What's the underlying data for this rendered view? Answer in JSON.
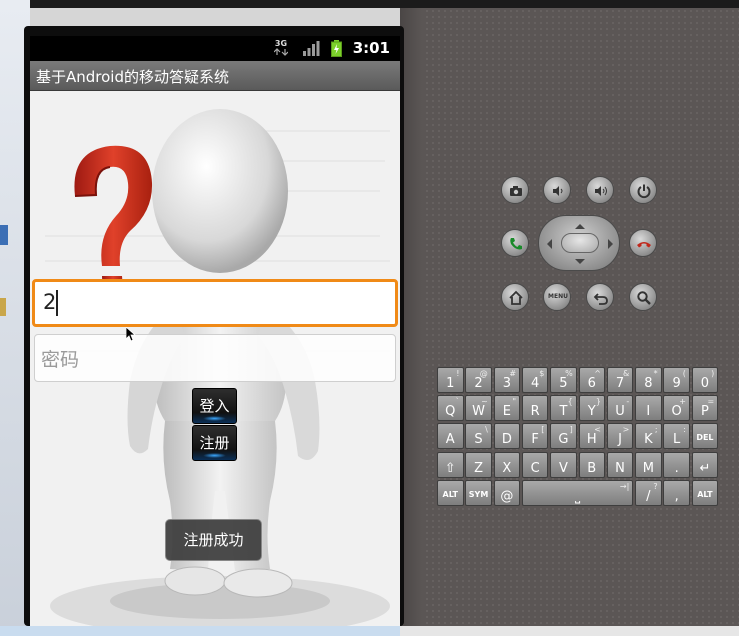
{
  "status_bar": {
    "network": "3G",
    "time": "3:01"
  },
  "app": {
    "title": "基于Android的移动答疑系统"
  },
  "form": {
    "username_value": "2",
    "password_placeholder": "密码",
    "login_label": "登入",
    "register_label": "注册"
  },
  "toast": {
    "message": "注册成功"
  },
  "hardware": {
    "buttons": [
      "camera-icon",
      "volume-down-icon",
      "volume-up-icon",
      "power-icon",
      "call-icon",
      "end-call-icon",
      "home-icon",
      "menu-button",
      "back-icon",
      "search-icon"
    ],
    "menu_label": "MENU"
  },
  "keyboard": {
    "rows": [
      [
        {
          "k": "1",
          "s": "!"
        },
        {
          "k": "2",
          "s": "@"
        },
        {
          "k": "3",
          "s": "#"
        },
        {
          "k": "4",
          "s": "$"
        },
        {
          "k": "5",
          "s": "%"
        },
        {
          "k": "6",
          "s": "^"
        },
        {
          "k": "7",
          "s": "&"
        },
        {
          "k": "8",
          "s": "*"
        },
        {
          "k": "9",
          "s": "("
        },
        {
          "k": "0",
          "s": ")"
        }
      ],
      [
        {
          "k": "Q",
          "s": "`"
        },
        {
          "k": "W",
          "s": "~"
        },
        {
          "k": "E",
          "s": "\""
        },
        {
          "k": "R",
          "s": ""
        },
        {
          "k": "T",
          "s": "{"
        },
        {
          "k": "Y",
          "s": "}"
        },
        {
          "k": "U",
          "s": "-"
        },
        {
          "k": "I",
          "s": ""
        },
        {
          "k": "O",
          "s": "+"
        },
        {
          "k": "P",
          "s": "="
        }
      ],
      [
        {
          "k": "A",
          "s": ""
        },
        {
          "k": "S",
          "s": "\\"
        },
        {
          "k": "D",
          "s": ""
        },
        {
          "k": "F",
          "s": "["
        },
        {
          "k": "G",
          "s": "]"
        },
        {
          "k": "H",
          "s": "<"
        },
        {
          "k": "J",
          "s": ">"
        },
        {
          "k": "K",
          "s": ";"
        },
        {
          "k": "L",
          "s": ":"
        },
        {
          "k": "DEL",
          "s": ""
        }
      ],
      [
        {
          "k": "⇧",
          "s": ""
        },
        {
          "k": "Z",
          "s": ""
        },
        {
          "k": "X",
          "s": ""
        },
        {
          "k": "C",
          "s": ""
        },
        {
          "k": "V",
          "s": ""
        },
        {
          "k": "B",
          "s": ""
        },
        {
          "k": "N",
          "s": ""
        },
        {
          "k": "M",
          "s": ""
        },
        {
          "k": ".",
          "s": ""
        },
        {
          "k": "↵",
          "s": ""
        }
      ],
      [
        {
          "k": "ALT",
          "s": ""
        },
        {
          "k": "SYM",
          "s": ""
        },
        {
          "k": "@",
          "s": ""
        },
        {
          "k": "␣",
          "s": "→|"
        },
        {
          "k": "/",
          "s": "?"
        },
        {
          "k": ",",
          "s": ""
        },
        {
          "k": "ALT",
          "s": ""
        }
      ]
    ]
  },
  "colors": {
    "focus_border": "#f08a17",
    "skin": "#5b5655",
    "button_glow": "#3aa7ff"
  }
}
